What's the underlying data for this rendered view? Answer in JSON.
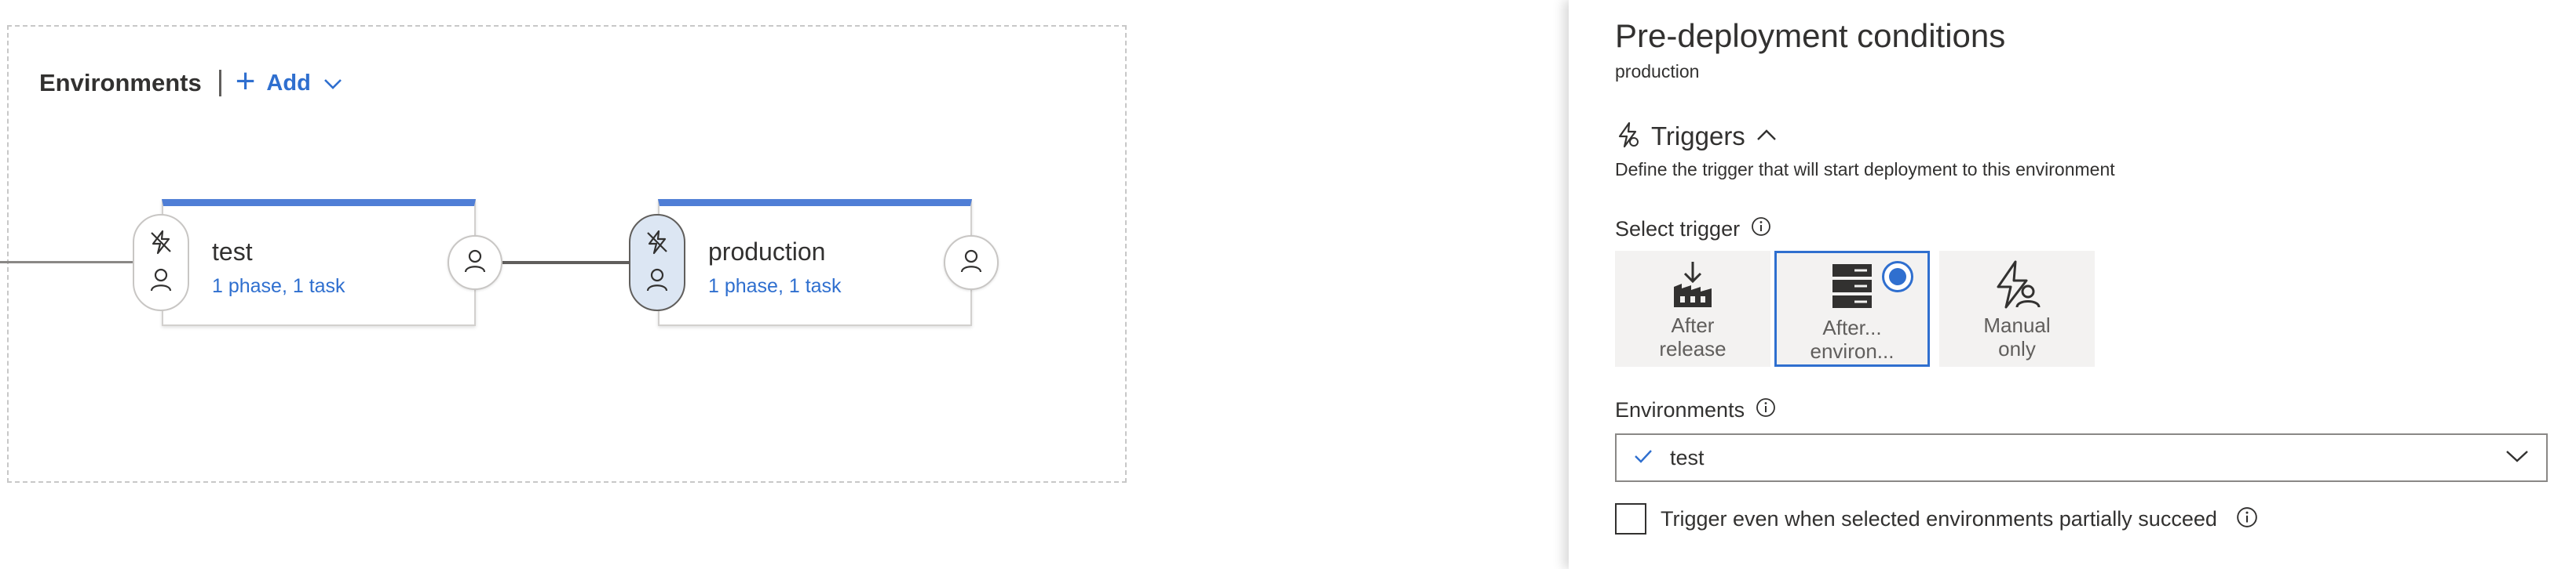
{
  "canvas": {
    "environments_title": "Environments",
    "add_label": "Add",
    "stages": [
      {
        "name": "test",
        "summary": "1 phase, 1 task"
      },
      {
        "name": "production",
        "summary": "1 phase, 1 task"
      }
    ]
  },
  "panel": {
    "title": "Pre-deployment conditions",
    "subtitle": "production",
    "triggers": {
      "label": "Triggers",
      "description": "Define the trigger that will start deployment to this environment",
      "select_label": "Select trigger",
      "options": [
        {
          "line1": "After",
          "line2": "release",
          "icon": "release-download-icon",
          "selected": false
        },
        {
          "line1": "After...",
          "line2": "environ...",
          "icon": "server-stack-icon",
          "selected": true
        },
        {
          "line1": "Manual",
          "line2": "only",
          "icon": "manual-trigger-icon",
          "selected": false
        }
      ]
    },
    "environments": {
      "label": "Environments",
      "selected_value": "test"
    },
    "partial_checkbox": {
      "label": "Trigger even when selected environments partially succeed",
      "checked": false
    }
  },
  "colors": {
    "accent": "#2f6fcf",
    "card_top_bar": "#4f7ed6",
    "selected_pill": "#dce6f3",
    "tile_background": "#f3f2f1"
  }
}
